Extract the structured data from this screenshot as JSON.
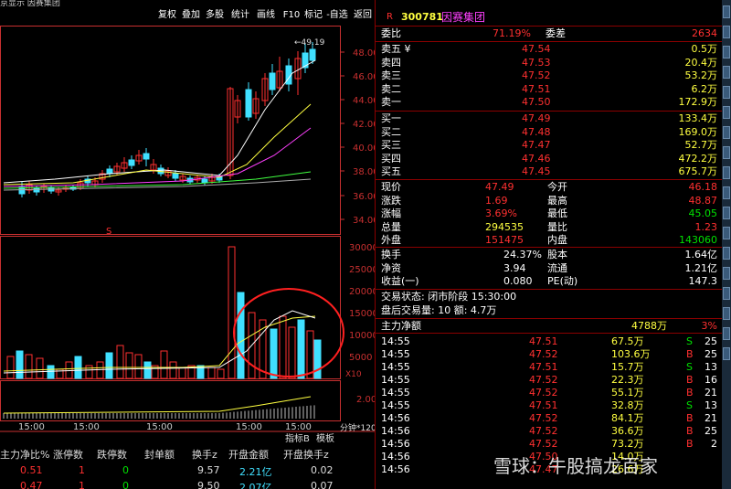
{
  "top_bar": {
    "left_text": "京显示 因赛集团",
    "code": "300781",
    "name": "因赛集团"
  },
  "toolbar": [
    "复权",
    "叠加",
    "多股",
    "统计",
    "画线",
    "F10",
    "标记",
    "-自选",
    "返回"
  ],
  "price_axis": [
    "48.00",
    "46.00",
    "44.00",
    "42.00",
    "40.00",
    "38.00",
    "36.00",
    "34.00"
  ],
  "vol_axis": [
    "30000",
    "25000",
    "20000",
    "15000",
    "10000",
    "5000"
  ],
  "vol_unit": "X10",
  "ind_axis": "2.00",
  "high_label": "49.19",
  "time_labels": [
    "15:00",
    "15:00",
    "15:00",
    "15:00",
    "15:00"
  ],
  "bottom_tabs": {
    "indicator": "指标B",
    "template": "模板",
    "period": "分钟*120"
  },
  "order_book": {
    "weibi_label": "委比",
    "weibi_value": "71.19%",
    "weicha_label": "委差",
    "weicha_value": "2634",
    "asks": [
      {
        "label": "卖五 ¥",
        "price": "47.54",
        "vol": "0.5万"
      },
      {
        "label": "卖四",
        "price": "47.53",
        "vol": "20.4万"
      },
      {
        "label": "卖三",
        "price": "47.52",
        "vol": "53.2万"
      },
      {
        "label": "卖二",
        "price": "47.51",
        "vol": "6.2万"
      },
      {
        "label": "卖一",
        "price": "47.50",
        "vol": "172.9万"
      }
    ],
    "bids": [
      {
        "label": "买一",
        "price": "47.49",
        "vol": "133.4万"
      },
      {
        "label": "买二",
        "price": "47.48",
        "vol": "169.0万"
      },
      {
        "label": "买三",
        "price": "47.47",
        "vol": "52.7万"
      },
      {
        "label": "买四",
        "price": "47.46",
        "vol": "472.2万"
      },
      {
        "label": "买五",
        "price": "47.45",
        "vol": "675.7万"
      }
    ]
  },
  "quote": [
    {
      "l1": "现价",
      "v1": "47.49",
      "l2": "今开",
      "v2": "46.18",
      "c1": "red",
      "c2": "red"
    },
    {
      "l1": "涨跌",
      "v1": "1.69",
      "l2": "最高",
      "v2": "48.87",
      "c1": "red",
      "c2": "red"
    },
    {
      "l1": "涨幅",
      "v1": "3.69%",
      "l2": "最低",
      "v2": "45.05",
      "c1": "red",
      "c2": "green"
    },
    {
      "l1": "总量",
      "v1": "294535",
      "l2": "量比",
      "v2": "1.23",
      "c1": "yellow",
      "c2": "red"
    },
    {
      "l1": "外盘",
      "v1": "151475",
      "l2": "内盘",
      "v2": "143060",
      "c1": "red",
      "c2": "green"
    }
  ],
  "stats": [
    {
      "l1": "换手",
      "v1": "24.37%",
      "l2": "股本",
      "v2": "1.64亿"
    },
    {
      "l1": "净资",
      "v1": "3.94",
      "l2": "流通",
      "v2": "1.21亿"
    },
    {
      "l1": "收益(一)",
      "v1": "0.080",
      "l2": "PE(动)",
      "v2": "147.3"
    }
  ],
  "trade_status": {
    "text": "交易状态: 闭市阶段 15:30:00",
    "after": "盘后交易量: 10 额: 4.7万"
  },
  "net_flow": {
    "label": "主力净额",
    "value": "4788万",
    "pct": "3%"
  },
  "ticks": [
    {
      "t": "14:55",
      "p": "47.51",
      "v": "67.5万",
      "d": "S",
      "n": "25"
    },
    {
      "t": "14:55",
      "p": "47.52",
      "v": "103.6万",
      "d": "B",
      "n": "25"
    },
    {
      "t": "14:55",
      "p": "47.51",
      "v": "15.7万",
      "d": "S",
      "n": "13"
    },
    {
      "t": "14:55",
      "p": "47.52",
      "v": "22.3万",
      "d": "B",
      "n": "16"
    },
    {
      "t": "14:55",
      "p": "47.52",
      "v": "55.1万",
      "d": "B",
      "n": "21"
    },
    {
      "t": "14:55",
      "p": "47.51",
      "v": "32.8万",
      "d": "S",
      "n": "13"
    },
    {
      "t": "14:56",
      "p": "47.52",
      "v": "84.1万",
      "d": "B",
      "n": "21"
    },
    {
      "t": "14:56",
      "p": "47.52",
      "v": "36.6万",
      "d": "B",
      "n": "25"
    },
    {
      "t": "14:56",
      "p": "47.52",
      "v": "73.2万",
      "d": "B",
      "n": "2"
    },
    {
      "t": "14:56",
      "p": "47.50",
      "v": "14.0万",
      "d": "",
      "n": ""
    },
    {
      "t": "14:56",
      "p": "47.47",
      "v": "26.6万",
      "d": "",
      "n": ""
    }
  ],
  "bottom_table": {
    "headers": [
      "主力净比%",
      "涨停数",
      "跌停数",
      "封单额",
      "换手z",
      "开盘金额",
      "开盘换手z"
    ],
    "rows": [
      [
        "0.51",
        "1",
        "0",
        "",
        "9.57",
        "2.21亿",
        "0.02"
      ],
      [
        "0.47",
        "1",
        "0",
        "",
        "9.50",
        "2.07亿",
        "0.07"
      ]
    ]
  },
  "watermark": "雪球：牛股搞龙百家"
}
